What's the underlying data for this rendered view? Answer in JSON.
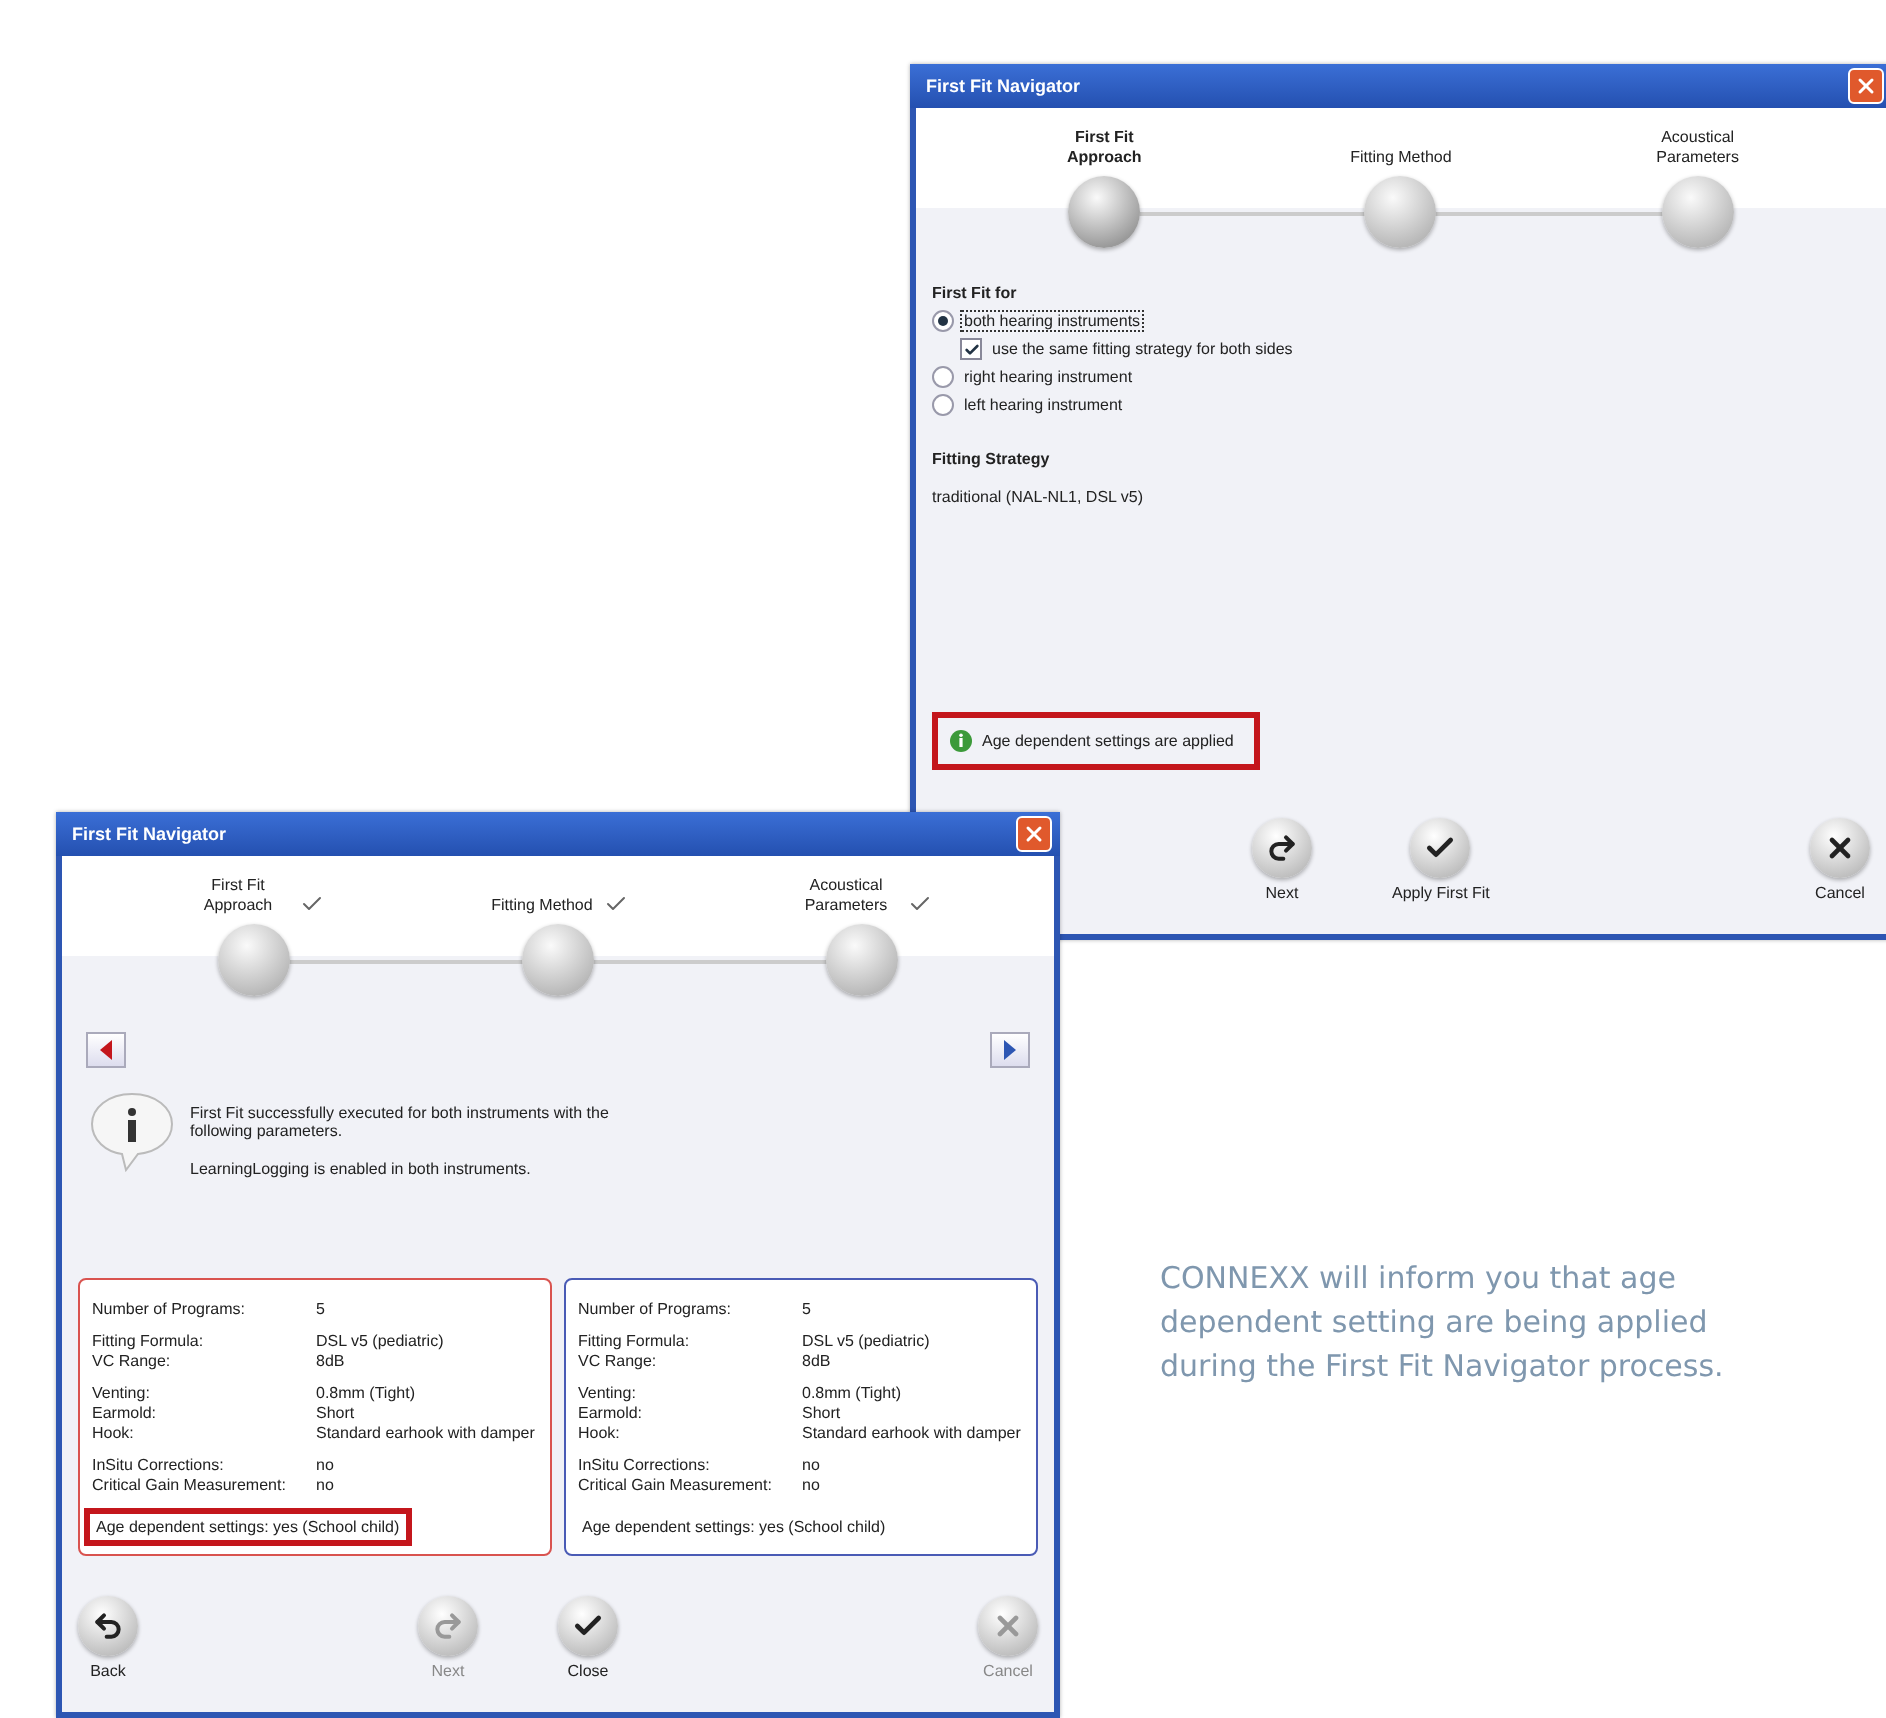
{
  "setup_window": {
    "title": "First Fit Navigator",
    "steps": [
      {
        "label": "First Fit Approach",
        "selected": true,
        "done": false
      },
      {
        "label": "Fitting Method",
        "selected": false,
        "done": false
      },
      {
        "label": "Acoustical Parameters",
        "selected": false,
        "done": false
      }
    ],
    "fit_for": {
      "heading": "First Fit for",
      "options": [
        {
          "kind": "radio",
          "label": "both hearing instruments",
          "selected": true
        },
        {
          "kind": "checkbox",
          "label": "use the same fitting strategy for both sides",
          "checked": true
        },
        {
          "kind": "radio",
          "label": "right hearing instrument",
          "selected": false
        },
        {
          "kind": "radio",
          "label": "left hearing instrument",
          "selected": false
        }
      ]
    },
    "strategy": {
      "heading": "Fitting Strategy",
      "value": "traditional (NAL-NL1, DSL v5)"
    },
    "notice": {
      "text": "Age dependent settings are applied",
      "highlighted": true
    },
    "buttons": [
      {
        "kind": "next",
        "label": "Next",
        "disabled": false
      },
      {
        "kind": "apply",
        "label": "Apply First Fit",
        "disabled": false
      },
      {
        "kind": "cancel",
        "label": "Cancel",
        "disabled": false
      }
    ]
  },
  "result_window": {
    "title": "First Fit Navigator",
    "steps": [
      {
        "label": "First Fit Approach",
        "selected": false,
        "done": true
      },
      {
        "label": "Fitting Method",
        "selected": false,
        "done": true
      },
      {
        "label": "Acoustical Parameters",
        "selected": false,
        "done": true
      }
    ],
    "message": [
      "First Fit successfully executed for both instruments with the following parameters.",
      "LearningLogging is enabled in both instruments."
    ],
    "panels": [
      {
        "color": "#d9534f",
        "groups": [
          [
            {
              "label": "Number of Programs:",
              "value": "5"
            }
          ],
          [
            {
              "label": "Fitting Formula:",
              "value": "DSL v5 (pediatric)"
            },
            {
              "label": "VC Range:",
              "value": "8dB"
            }
          ],
          [
            {
              "label": "Venting:",
              "value": "0.8mm (Tight)"
            },
            {
              "label": "Earmold:",
              "value": "Short"
            },
            {
              "label": "Hook:",
              "value": "Standard earhook with damper"
            }
          ],
          [
            {
              "label": "InSitu Corrections:",
              "value": "no"
            },
            {
              "label": "Critical Gain Measurement:",
              "value": "no"
            }
          ]
        ],
        "footer": {
          "text": "Age dependent settings: yes (School child)",
          "highlighted": true
        }
      },
      {
        "color": "#4a5bb5",
        "groups": [
          [
            {
              "label": "Number of Programs:",
              "value": "5"
            }
          ],
          [
            {
              "label": "Fitting Formula:",
              "value": "DSL v5 (pediatric)"
            },
            {
              "label": "VC Range:",
              "value": "8dB"
            }
          ],
          [
            {
              "label": "Venting:",
              "value": "0.8mm (Tight)"
            },
            {
              "label": "Earmold:",
              "value": "Short"
            },
            {
              "label": "Hook:",
              "value": "Standard earhook with damper"
            }
          ],
          [
            {
              "label": "InSitu Corrections:",
              "value": "no"
            },
            {
              "label": "Critical Gain Measurement:",
              "value": "no"
            }
          ]
        ],
        "footer": {
          "text": "Age dependent settings: yes (School child)",
          "highlighted": false
        }
      }
    ],
    "buttons": [
      {
        "kind": "back",
        "label": "Back",
        "disabled": false
      },
      {
        "kind": "next",
        "label": "Next",
        "disabled": true
      },
      {
        "kind": "close",
        "label": "Close",
        "disabled": false
      },
      {
        "kind": "cancel",
        "label": "Cancel",
        "disabled": true
      }
    ]
  },
  "caption": "CONNEXX will inform you that age dependent setting are being applied during the First Fit Navigator process."
}
